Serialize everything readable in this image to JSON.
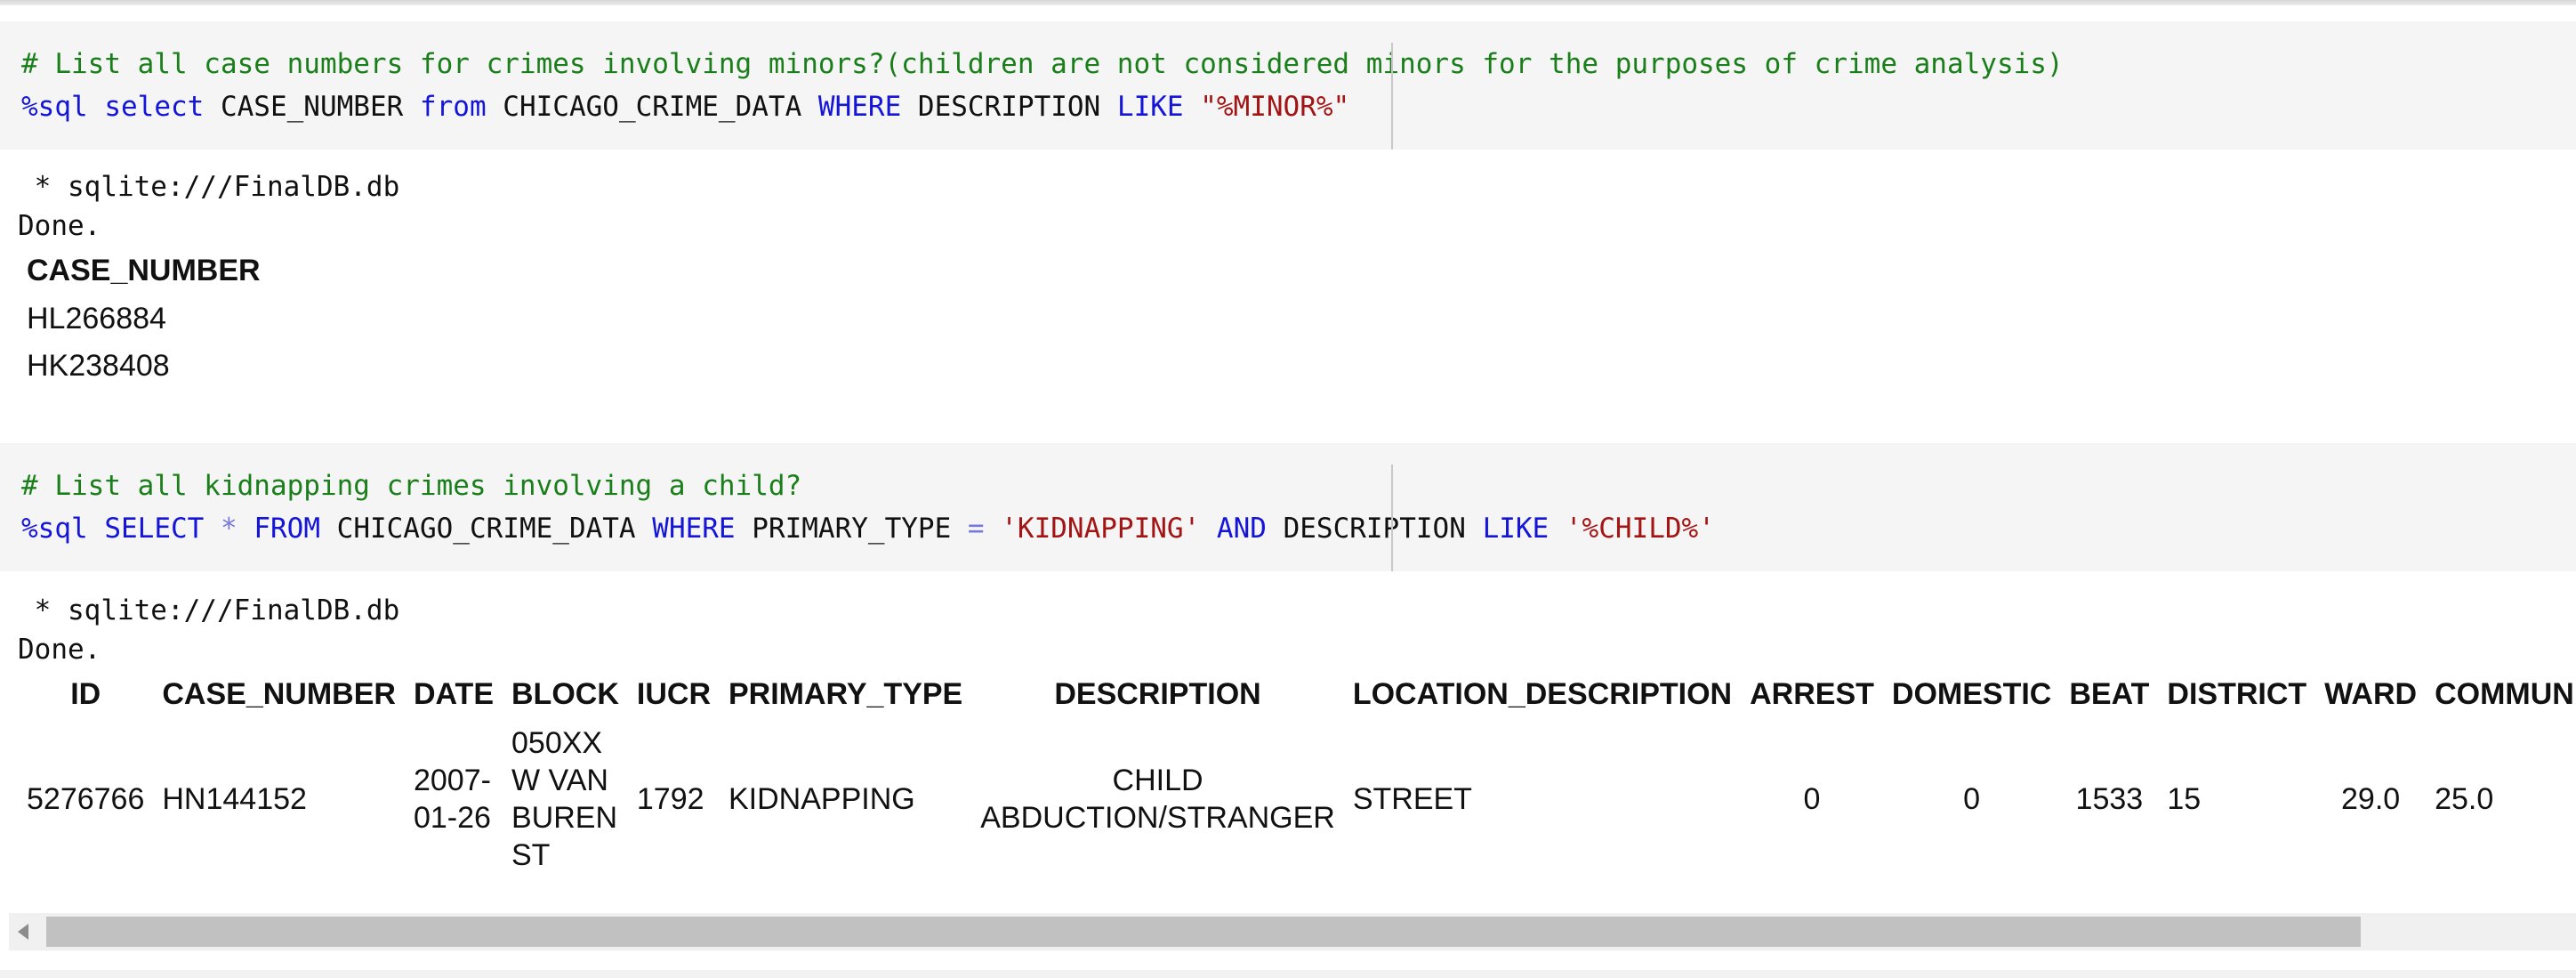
{
  "cell1": {
    "comment": "# List all case numbers for crimes involving minors?(children are not considered minors for the purposes of crime analysis)",
    "magic": "%sql",
    "kw_select": "select",
    "col": "CASE_NUMBER",
    "kw_from": "from",
    "table": "CHICAGO_CRIME_DATA",
    "kw_where": "WHERE",
    "field": "DESCRIPTION",
    "kw_like": "LIKE",
    "pattern": "\"%MINOR%\""
  },
  "output1": {
    "connection": " * sqlite:///FinalDB.db",
    "status": "Done.",
    "header": "CASE_NUMBER",
    "rows": [
      "HL266884",
      "HK238408"
    ]
  },
  "cell2": {
    "comment": "# List all kidnapping crimes involving a child?",
    "magic": "%sql",
    "kw_select": "SELECT",
    "star": "*",
    "kw_from": "FROM",
    "table": "CHICAGO_CRIME_DATA",
    "kw_where": "WHERE",
    "field1": "PRIMARY_TYPE",
    "eq": "=",
    "value1": "'KIDNAPPING'",
    "kw_and": "AND",
    "field2": "DESCRIPTION",
    "kw_like": "LIKE",
    "pattern": "'%CHILD%'"
  },
  "output2": {
    "connection": " * sqlite:///FinalDB.db",
    "status": "Done.",
    "headers": [
      "ID",
      "CASE_NUMBER",
      "DATE",
      "BLOCK",
      "IUCR",
      "PRIMARY_TYPE",
      "DESCRIPTION",
      "LOCATION_DESCRIPTION",
      "ARREST",
      "DOMESTIC",
      "BEAT",
      "DISTRICT",
      "WARD",
      "COMMUNITY_"
    ],
    "row": [
      "5276766",
      "HN144152",
      "2007-01-26",
      "050XX W VAN BUREN ST",
      "1792",
      "KIDNAPPING",
      "CHILD ABDUCTION/STRANGER",
      "STREET",
      "0",
      "0",
      "1533",
      "15",
      "29.0",
      "25.0"
    ]
  },
  "scrollbar": {
    "left_arrow_icon": "triangle-left-icon"
  }
}
